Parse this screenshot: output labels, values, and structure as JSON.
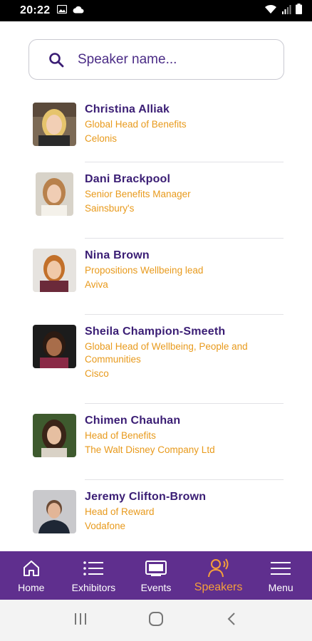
{
  "status_bar": {
    "time": "20:22"
  },
  "search": {
    "placeholder": "Speaker name..."
  },
  "speakers": [
    {
      "name": "Christina Alliak",
      "role": "Global Head of Benefits",
      "company": "Celonis"
    },
    {
      "name": "Dani Brackpool",
      "role": "Senior Benefits Manager",
      "company": "Sainsbury's"
    },
    {
      "name": "Nina Brown",
      "role": "Propositions Wellbeing lead",
      "company": "Aviva"
    },
    {
      "name": "Sheila Champion-Smeeth",
      "role": "Global Head of Wellbeing, People and Communities",
      "company": "Cisco"
    },
    {
      "name": "Chimen Chauhan",
      "role": "Head of Benefits",
      "company": "The Walt Disney Company Ltd"
    },
    {
      "name": "Jeremy Clifton-Brown",
      "role": "Head of Reward",
      "company": "Vodafone"
    }
  ],
  "bottom_nav": {
    "items": [
      {
        "label": "Home",
        "icon": "home-icon"
      },
      {
        "label": "Exhibitors",
        "icon": "list-icon"
      },
      {
        "label": "Events",
        "icon": "screen-icon"
      },
      {
        "label": "Speakers",
        "icon": "speaker-icon",
        "active": true
      },
      {
        "label": "Menu",
        "icon": "hamburger-icon"
      }
    ]
  },
  "colors": {
    "primary": "#5f2f8e",
    "name_text": "#3a1d74",
    "accent": "#e89a1c",
    "active_nav": "#f5a03a"
  }
}
